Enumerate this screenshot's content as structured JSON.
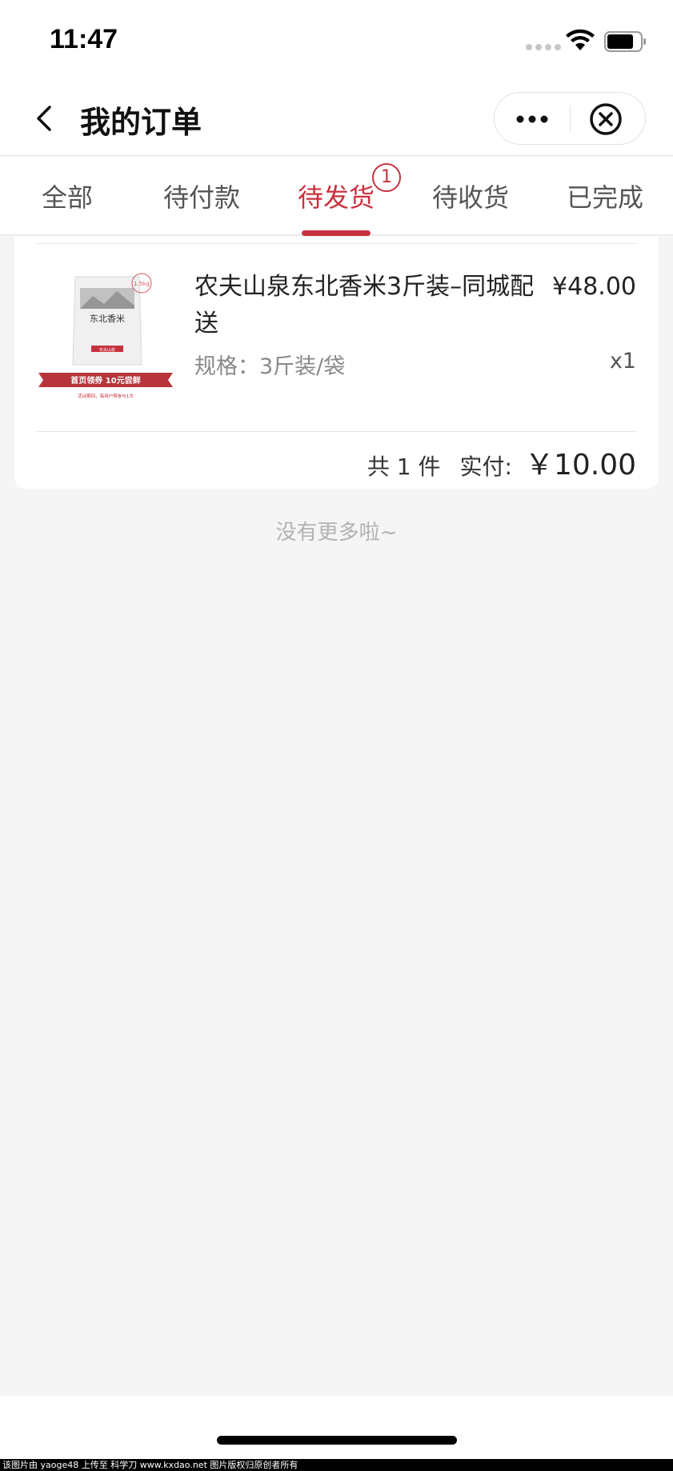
{
  "status_bar": {
    "time": "11:47"
  },
  "nav": {
    "title": "我的订单"
  },
  "tabs": [
    {
      "label": "全部",
      "active": false
    },
    {
      "label": "待付款",
      "active": false
    },
    {
      "label": "待发货",
      "active": true,
      "badge": "1"
    },
    {
      "label": "待收货",
      "active": false
    },
    {
      "label": "已完成",
      "active": false
    }
  ],
  "order": {
    "product_name": "农夫山泉东北香米3斤装–同城配送",
    "price": "¥48.00",
    "spec": "规格：3斤装/袋",
    "quantity": "x1",
    "count_text": "共 1 件",
    "paid_label": "实付:",
    "paid_total": "￥10.00",
    "image": {
      "bag_title": "东北香米",
      "weight_tag": "1.5kg",
      "brand_label": "农夫山泉",
      "banner_text": "首页领券 10元尝鲜",
      "fine_print": "活动期间，每用户限参与1次"
    }
  },
  "footer_text": "没有更多啦~",
  "watermark": "该图片由 yaoge48 上传至 科学刀 www.kxdao.net 图片版权归原创者所有",
  "colors": {
    "accent": "#c8323f",
    "background": "#f5f5f5"
  }
}
